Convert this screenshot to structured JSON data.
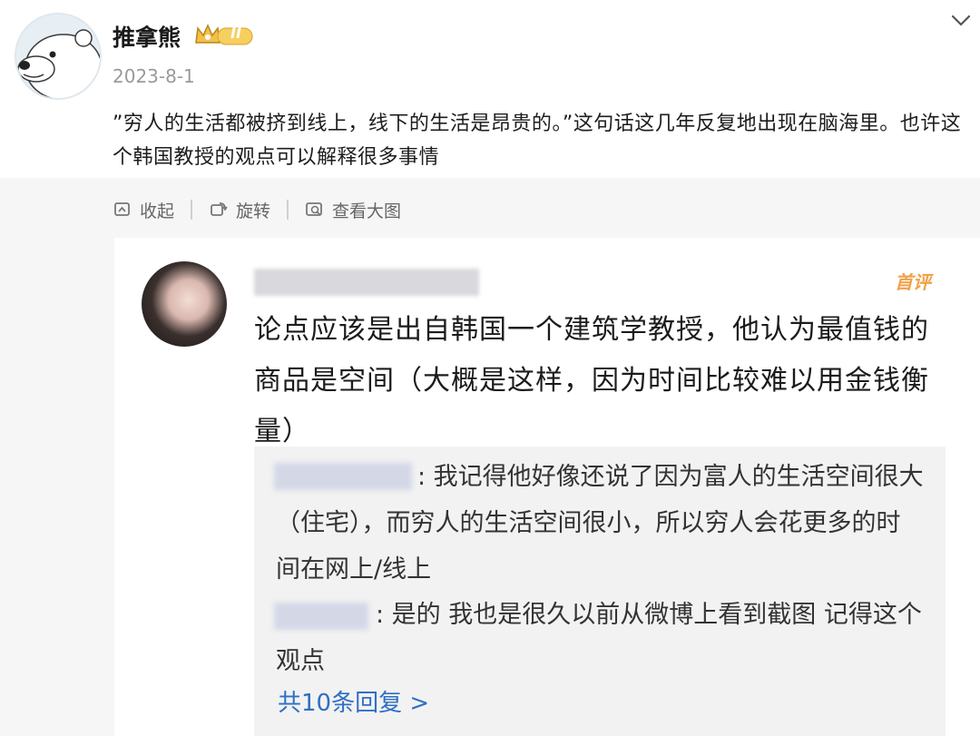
{
  "post": {
    "username": "推拿熊",
    "vip_badge": "II",
    "date": "2023-8-1",
    "text": "”穷人的生活都被挤到线上，线下的生活是昂贵的。”这句话这几年反复地出现在脑海里。也许这个韩国教授的观点可以解释很多事情"
  },
  "toolbar": {
    "collapse": "收起",
    "rotate": "旋转",
    "view_large": "查看大图"
  },
  "screenshot": {
    "badge": "首评",
    "comment": "论点应该是出自韩国一个建筑学教授，他认为最值钱的商品是空间（大概是这样，因为时间比较难以用金钱衡量）",
    "replies": [
      {
        "text": ": 我记得他好像还说了因为富人的生活空间很大（住宅），而穷人的生活空间很小，所以穷人会花更多的时间在网上/线上"
      },
      {
        "text": ": 是的 我也是很久以前从微博上看到截图 记得这个观点"
      }
    ],
    "more_replies": "共10条回复 >"
  },
  "colors": {
    "link_blue": "#2f6fc4",
    "badge_orange": "#f0a24a",
    "muted_gray": "#9a9a9a"
  },
  "icons": [
    "polar-bear-avatar",
    "crown-badge-icon",
    "chevron-down-icon",
    "collapse-icon",
    "rotate-icon",
    "view-large-icon"
  ]
}
